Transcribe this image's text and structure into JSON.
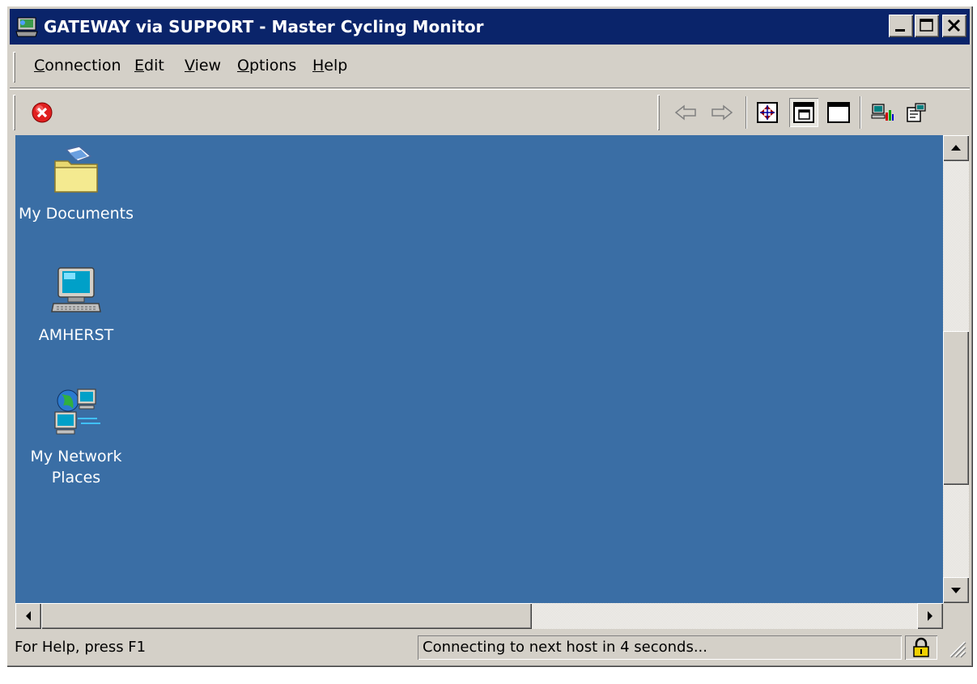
{
  "window": {
    "title": "GATEWAY via SUPPORT - Master Cycling Monitor",
    "icon": "remote-desktop-icon",
    "controls": [
      "minimize-icon",
      "maximize-icon",
      "close-icon"
    ]
  },
  "menu": {
    "items": [
      {
        "label": "Connection",
        "accel": "C"
      },
      {
        "label": "Edit",
        "accel": "E"
      },
      {
        "label": "View",
        "accel": "V"
      },
      {
        "label": "Options",
        "accel": "O"
      },
      {
        "label": "Help",
        "accel": "H"
      }
    ]
  },
  "toolbar": {
    "left": [
      "disconnect-icon"
    ],
    "right": [
      "back-arrow-icon",
      "forward-arrow-icon",
      "fit-to-window-icon",
      "windowed-view-icon",
      "full-screen-icon",
      "connection-properties-icon",
      "settings-icon"
    ]
  },
  "desktop": {
    "background": "#3a6ea5",
    "icons": [
      {
        "label": "My Documents",
        "icon": "folder-documents-icon"
      },
      {
        "label": "AMHERST",
        "icon": "computer-icon"
      },
      {
        "label": "My Network\nPlaces",
        "icon": "network-places-icon"
      }
    ]
  },
  "status": {
    "help": "For Help, press F1",
    "message": "Connecting to next host in 4 seconds...",
    "lock_icon": "lock-icon"
  }
}
